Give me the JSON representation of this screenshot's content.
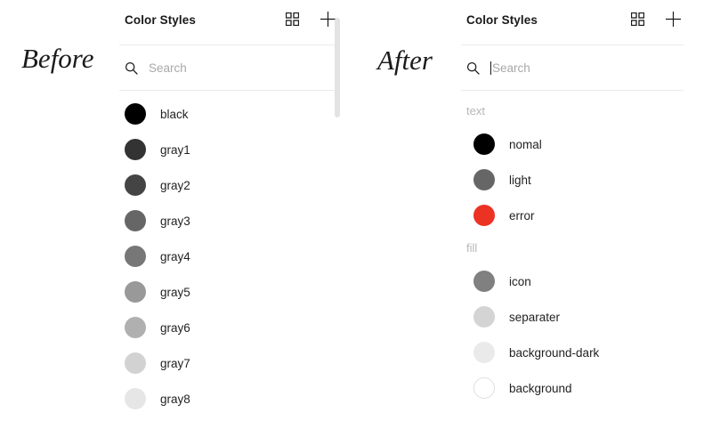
{
  "annotations": {
    "before_label": "Before",
    "after_label": "After"
  },
  "colors": {
    "accent_red": "#ec3223",
    "text_primary": "#222222",
    "text_muted": "#a8a8a8",
    "group_label": "#b6b6b6",
    "divider": "#ececec",
    "scrollbar_thumb": "#e3e3e3"
  },
  "before_panel": {
    "title": "Color Styles",
    "grid_icon": "grid-view-icon",
    "add_icon": "plus-icon",
    "search": {
      "icon": "search-icon",
      "placeholder": "Search",
      "value": "",
      "caret_visible": false
    },
    "items": [
      {
        "label": "black",
        "swatch": "#000000"
      },
      {
        "label": "gray1",
        "swatch": "#333333"
      },
      {
        "label": "gray2",
        "swatch": "#444444"
      },
      {
        "label": "gray3",
        "swatch": "#666666"
      },
      {
        "label": "gray4",
        "swatch": "#777777"
      },
      {
        "label": "gray5",
        "swatch": "#999999"
      },
      {
        "label": "gray6",
        "swatch": "#b0b0b0"
      },
      {
        "label": "gray7",
        "swatch": "#d2d2d2"
      },
      {
        "label": "gray8",
        "swatch": "#e6e6e6"
      }
    ],
    "scrollbar": {
      "visible": true
    }
  },
  "after_panel": {
    "title": "Color Styles",
    "grid_icon": "grid-view-icon",
    "add_icon": "plus-icon",
    "search": {
      "icon": "search-icon",
      "placeholder": "Search",
      "value": "",
      "caret_visible": true
    },
    "groups": [
      {
        "label": "text",
        "items": [
          {
            "label": "nomal",
            "swatch": "#000000",
            "bordered": false
          },
          {
            "label": "light",
            "swatch": "#666666",
            "bordered": false
          },
          {
            "label": "error",
            "swatch": "#ec3223",
            "bordered": false
          }
        ]
      },
      {
        "label": "fill",
        "items": [
          {
            "label": "icon",
            "swatch": "#808080",
            "bordered": false
          },
          {
            "label": "separater",
            "swatch": "#d4d4d4",
            "bordered": false
          },
          {
            "label": "background-dark",
            "swatch": "#eaeaea",
            "bordered": false
          },
          {
            "label": "background",
            "swatch": "#ffffff",
            "bordered": true
          }
        ]
      }
    ]
  }
}
